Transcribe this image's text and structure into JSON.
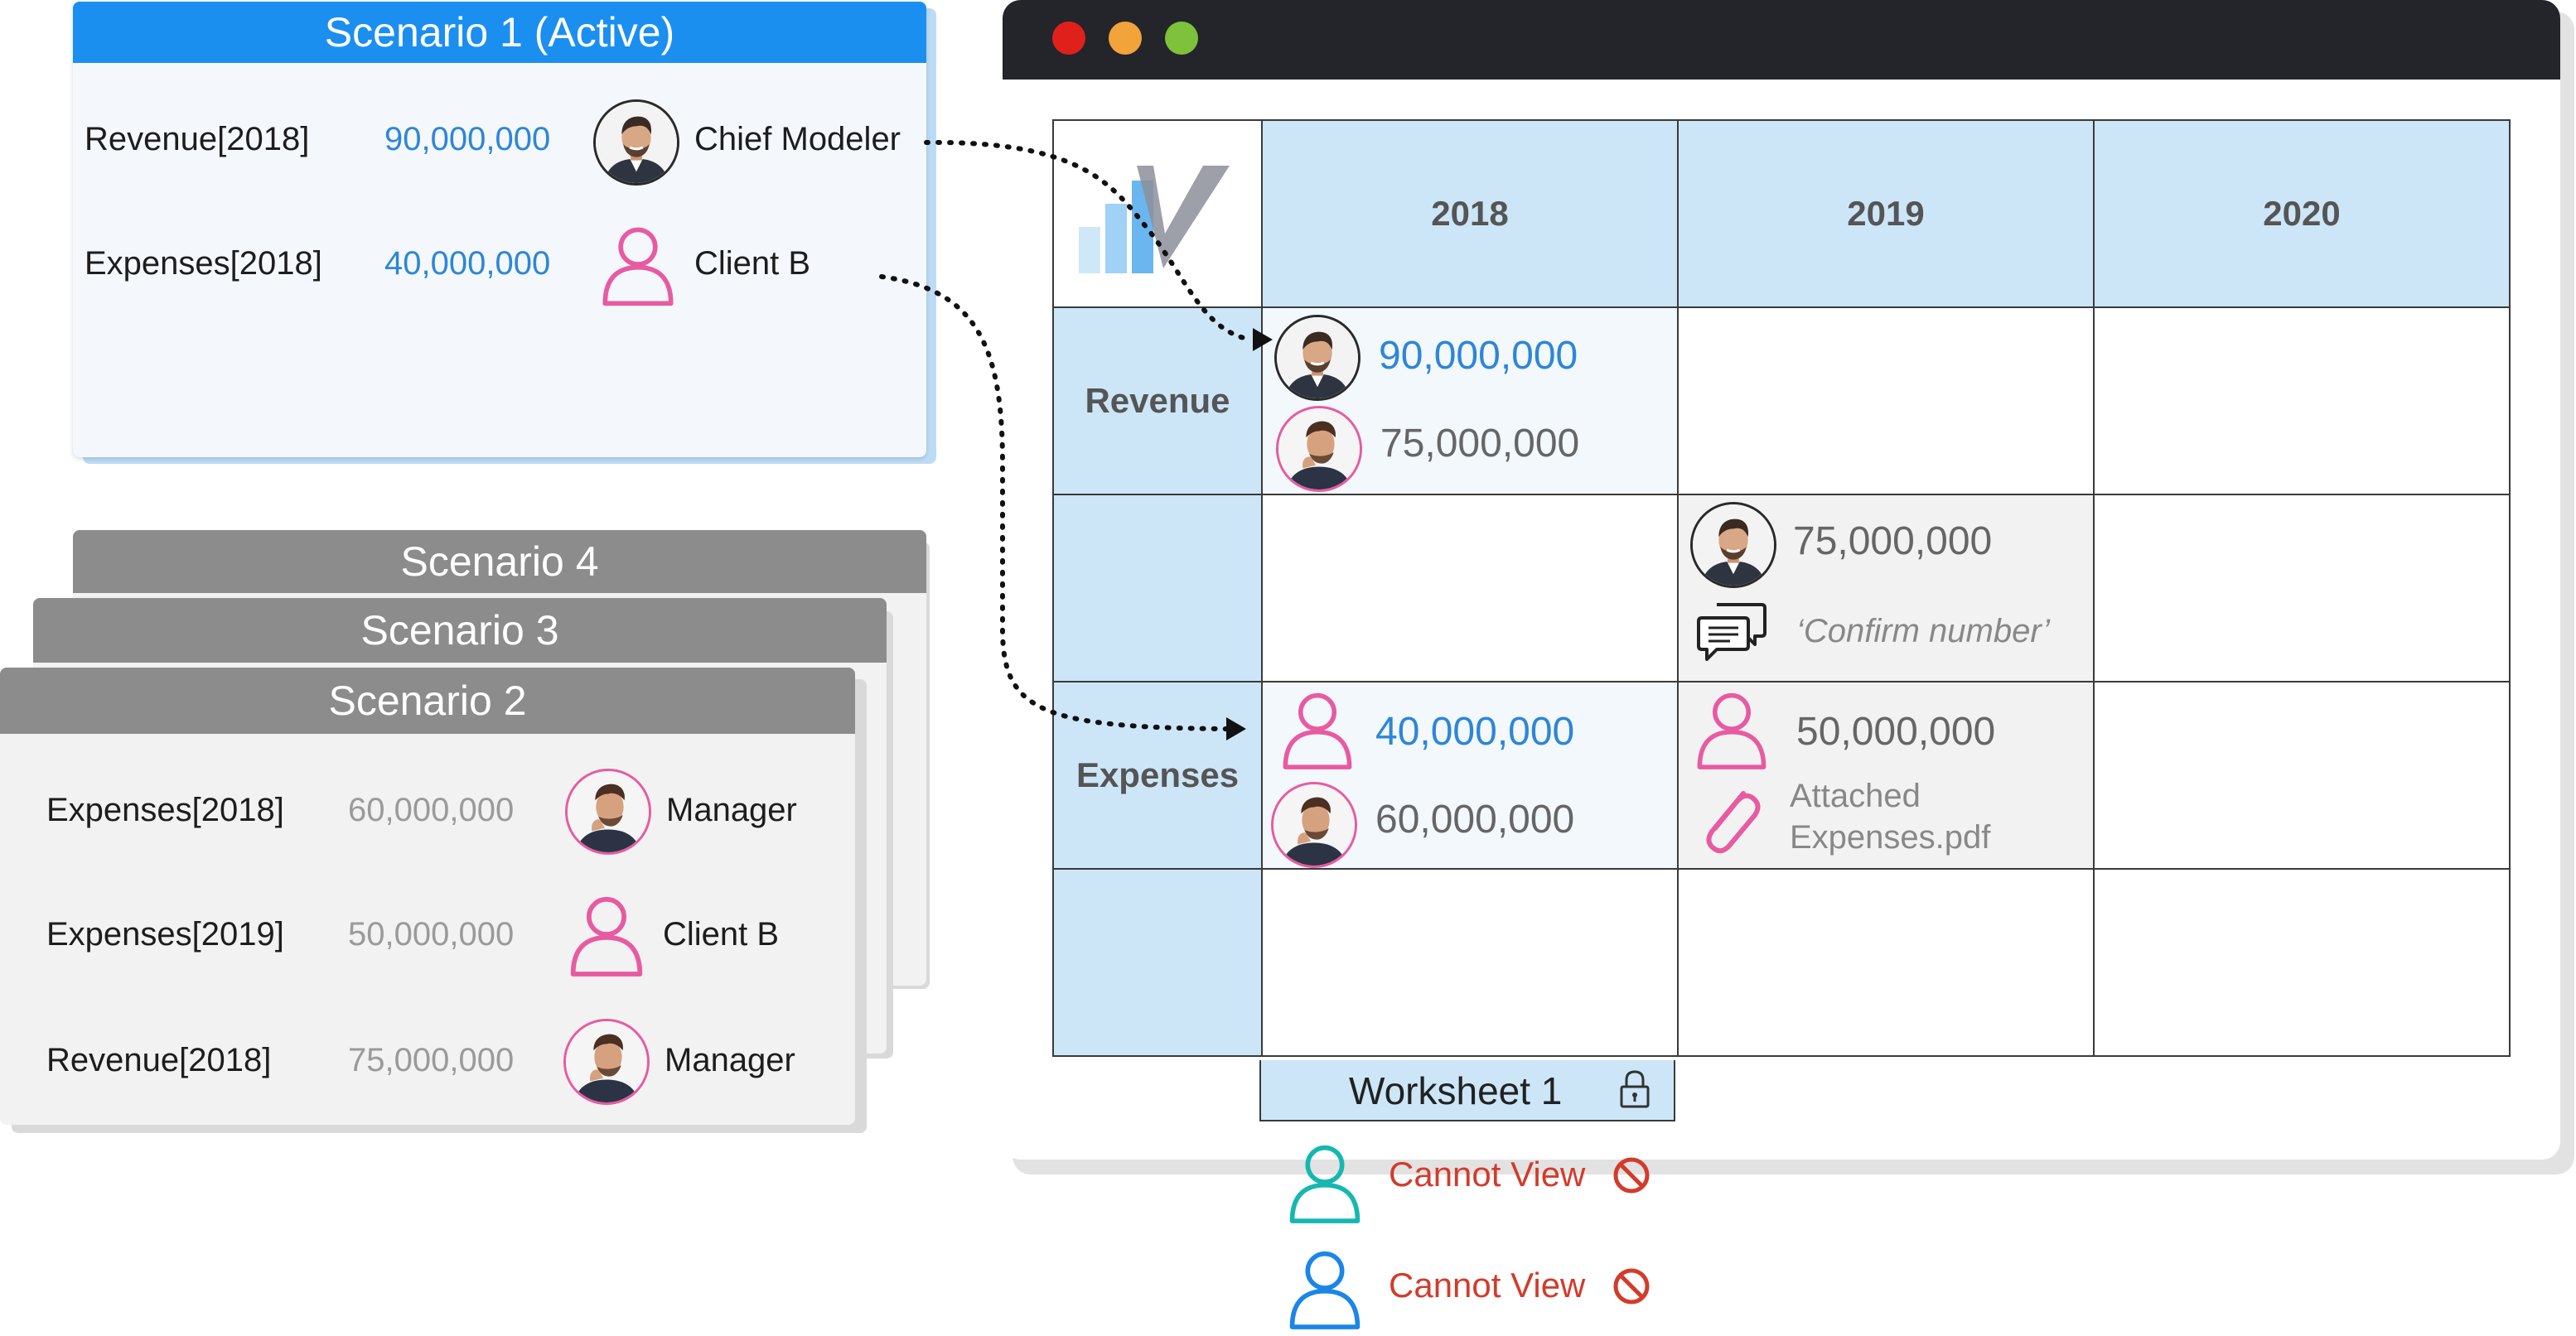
{
  "colors": {
    "accent_blue": "#1b8ff0",
    "value_blue": "#2d86d8",
    "pink": "#e85aa1",
    "teal": "#16b7b1",
    "blue_user": "#1b86e8",
    "warning_red": "#d33b2b",
    "header_grey": "#8c8c8c",
    "grid_header": "#cce6f8"
  },
  "scenario1": {
    "title": "Scenario 1 (Active)",
    "rows": [
      {
        "label": "Revenue[2018]",
        "value": "90,000,000",
        "user": "Chief Modeler",
        "avatar": "chief-modeler-photo"
      },
      {
        "label": "Expenses[2018]",
        "value": "40,000,000",
        "user": "Client B",
        "avatar": "pink-user-icon"
      }
    ]
  },
  "scenario4": {
    "title": "Scenario 4"
  },
  "scenario3": {
    "title": "Scenario 3"
  },
  "scenario2": {
    "title": "Scenario 2",
    "rows": [
      {
        "label": "Expenses[2018]",
        "value": "60,000,000",
        "user": "Manager",
        "avatar": "manager-photo"
      },
      {
        "label": "Expenses[2019]",
        "value": "50,000,000",
        "user": "Client B",
        "avatar": "pink-user-icon"
      },
      {
        "label": "Revenue[2018]",
        "value": "75,000,000",
        "user": "Manager",
        "avatar": "manager-photo"
      }
    ]
  },
  "window": {
    "controls": [
      "close-button",
      "minimize-button",
      "maximize-button"
    ]
  },
  "grid": {
    "columns": [
      "2018",
      "2019",
      "2020"
    ],
    "rows": [
      "Revenue",
      "",
      "Expenses",
      ""
    ],
    "revenue_2018": {
      "primary": "90,000,000",
      "secondary": "75,000,000"
    },
    "row2_2019": {
      "value": "75,000,000",
      "comment": "‘Confirm number’"
    },
    "expenses_2018": {
      "primary": "40,000,000",
      "secondary": "60,000,000"
    },
    "expenses_2019": {
      "value": "50,000,000",
      "attachment_line1": "Attached",
      "attachment_line2": "Expenses.pdf"
    }
  },
  "worksheet": {
    "label": "Worksheet 1",
    "permissions": [
      {
        "text": "Cannot View",
        "user_color": "teal"
      },
      {
        "text": "Cannot View",
        "user_color": "blue"
      }
    ]
  }
}
